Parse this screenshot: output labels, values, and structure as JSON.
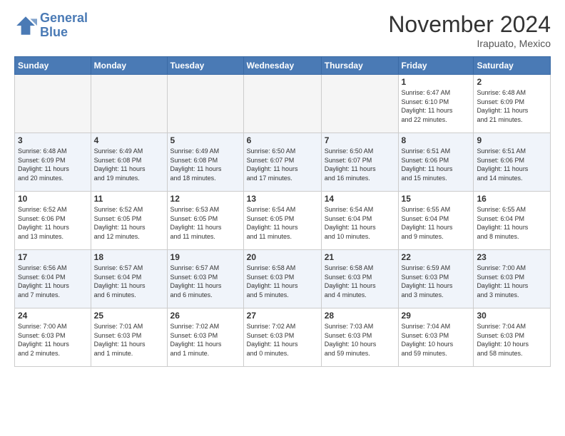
{
  "header": {
    "logo_line1": "General",
    "logo_line2": "Blue",
    "month": "November 2024",
    "location": "Irapuato, Mexico"
  },
  "weekdays": [
    "Sunday",
    "Monday",
    "Tuesday",
    "Wednesday",
    "Thursday",
    "Friday",
    "Saturday"
  ],
  "weeks": [
    [
      {
        "day": "",
        "info": ""
      },
      {
        "day": "",
        "info": ""
      },
      {
        "day": "",
        "info": ""
      },
      {
        "day": "",
        "info": ""
      },
      {
        "day": "",
        "info": ""
      },
      {
        "day": "1",
        "info": "Sunrise: 6:47 AM\nSunset: 6:10 PM\nDaylight: 11 hours\nand 22 minutes."
      },
      {
        "day": "2",
        "info": "Sunrise: 6:48 AM\nSunset: 6:09 PM\nDaylight: 11 hours\nand 21 minutes."
      }
    ],
    [
      {
        "day": "3",
        "info": "Sunrise: 6:48 AM\nSunset: 6:09 PM\nDaylight: 11 hours\nand 20 minutes."
      },
      {
        "day": "4",
        "info": "Sunrise: 6:49 AM\nSunset: 6:08 PM\nDaylight: 11 hours\nand 19 minutes."
      },
      {
        "day": "5",
        "info": "Sunrise: 6:49 AM\nSunset: 6:08 PM\nDaylight: 11 hours\nand 18 minutes."
      },
      {
        "day": "6",
        "info": "Sunrise: 6:50 AM\nSunset: 6:07 PM\nDaylight: 11 hours\nand 17 minutes."
      },
      {
        "day": "7",
        "info": "Sunrise: 6:50 AM\nSunset: 6:07 PM\nDaylight: 11 hours\nand 16 minutes."
      },
      {
        "day": "8",
        "info": "Sunrise: 6:51 AM\nSunset: 6:06 PM\nDaylight: 11 hours\nand 15 minutes."
      },
      {
        "day": "9",
        "info": "Sunrise: 6:51 AM\nSunset: 6:06 PM\nDaylight: 11 hours\nand 14 minutes."
      }
    ],
    [
      {
        "day": "10",
        "info": "Sunrise: 6:52 AM\nSunset: 6:06 PM\nDaylight: 11 hours\nand 13 minutes."
      },
      {
        "day": "11",
        "info": "Sunrise: 6:52 AM\nSunset: 6:05 PM\nDaylight: 11 hours\nand 12 minutes."
      },
      {
        "day": "12",
        "info": "Sunrise: 6:53 AM\nSunset: 6:05 PM\nDaylight: 11 hours\nand 11 minutes."
      },
      {
        "day": "13",
        "info": "Sunrise: 6:54 AM\nSunset: 6:05 PM\nDaylight: 11 hours\nand 11 minutes."
      },
      {
        "day": "14",
        "info": "Sunrise: 6:54 AM\nSunset: 6:04 PM\nDaylight: 11 hours\nand 10 minutes."
      },
      {
        "day": "15",
        "info": "Sunrise: 6:55 AM\nSunset: 6:04 PM\nDaylight: 11 hours\nand 9 minutes."
      },
      {
        "day": "16",
        "info": "Sunrise: 6:55 AM\nSunset: 6:04 PM\nDaylight: 11 hours\nand 8 minutes."
      }
    ],
    [
      {
        "day": "17",
        "info": "Sunrise: 6:56 AM\nSunset: 6:04 PM\nDaylight: 11 hours\nand 7 minutes."
      },
      {
        "day": "18",
        "info": "Sunrise: 6:57 AM\nSunset: 6:04 PM\nDaylight: 11 hours\nand 6 minutes."
      },
      {
        "day": "19",
        "info": "Sunrise: 6:57 AM\nSunset: 6:03 PM\nDaylight: 11 hours\nand 6 minutes."
      },
      {
        "day": "20",
        "info": "Sunrise: 6:58 AM\nSunset: 6:03 PM\nDaylight: 11 hours\nand 5 minutes."
      },
      {
        "day": "21",
        "info": "Sunrise: 6:58 AM\nSunset: 6:03 PM\nDaylight: 11 hours\nand 4 minutes."
      },
      {
        "day": "22",
        "info": "Sunrise: 6:59 AM\nSunset: 6:03 PM\nDaylight: 11 hours\nand 3 minutes."
      },
      {
        "day": "23",
        "info": "Sunrise: 7:00 AM\nSunset: 6:03 PM\nDaylight: 11 hours\nand 3 minutes."
      }
    ],
    [
      {
        "day": "24",
        "info": "Sunrise: 7:00 AM\nSunset: 6:03 PM\nDaylight: 11 hours\nand 2 minutes."
      },
      {
        "day": "25",
        "info": "Sunrise: 7:01 AM\nSunset: 6:03 PM\nDaylight: 11 hours\nand 1 minute."
      },
      {
        "day": "26",
        "info": "Sunrise: 7:02 AM\nSunset: 6:03 PM\nDaylight: 11 hours\nand 1 minute."
      },
      {
        "day": "27",
        "info": "Sunrise: 7:02 AM\nSunset: 6:03 PM\nDaylight: 11 hours\nand 0 minutes."
      },
      {
        "day": "28",
        "info": "Sunrise: 7:03 AM\nSunset: 6:03 PM\nDaylight: 10 hours\nand 59 minutes."
      },
      {
        "day": "29",
        "info": "Sunrise: 7:04 AM\nSunset: 6:03 PM\nDaylight: 10 hours\nand 59 minutes."
      },
      {
        "day": "30",
        "info": "Sunrise: 7:04 AM\nSunset: 6:03 PM\nDaylight: 10 hours\nand 58 minutes."
      }
    ]
  ]
}
